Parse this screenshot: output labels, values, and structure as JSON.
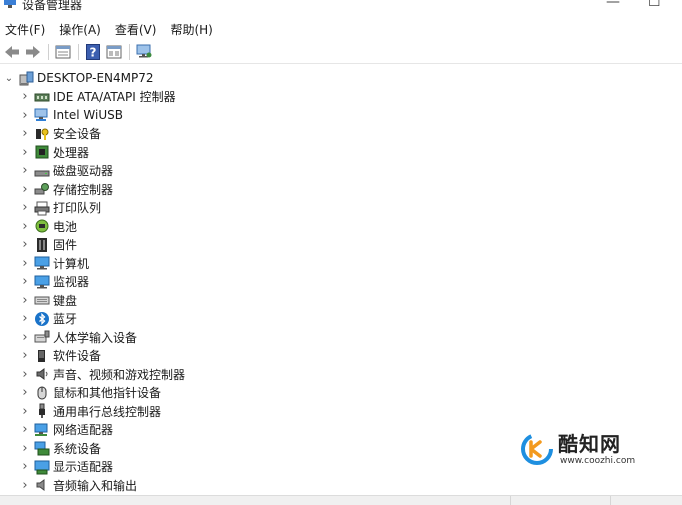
{
  "window": {
    "title": "设备管理器",
    "minimize_glyph": "—",
    "maximize_glyph": "☐"
  },
  "menu": [
    {
      "label": "文件(F)"
    },
    {
      "label": "操作(A)"
    },
    {
      "label": "查看(V)"
    },
    {
      "label": "帮助(H)"
    }
  ],
  "toolbar": {
    "buttons": [
      "back-arrow-icon",
      "forward-arrow-icon",
      "properties-icon",
      "help-icon",
      "view-icon",
      "monitor-scan-icon"
    ]
  },
  "tree": {
    "root": {
      "label": "DESKTOP-EN4MP72",
      "icon": "computer-tower-icon",
      "expanded": true
    },
    "items": [
      {
        "label": "IDE ATA/ATAPI 控制器",
        "icon": "ide-controller-icon"
      },
      {
        "label": "Intel WiUSB",
        "icon": "network-device-icon"
      },
      {
        "label": "安全设备",
        "icon": "security-key-icon"
      },
      {
        "label": "处理器",
        "icon": "processor-icon"
      },
      {
        "label": "磁盘驱动器",
        "icon": "disk-drive-icon"
      },
      {
        "label": "存储控制器",
        "icon": "storage-controller-icon"
      },
      {
        "label": "打印队列",
        "icon": "printer-icon"
      },
      {
        "label": "电池",
        "icon": "battery-icon"
      },
      {
        "label": "固件",
        "icon": "firmware-icon"
      },
      {
        "label": "计算机",
        "icon": "computer-icon"
      },
      {
        "label": "监视器",
        "icon": "monitor-icon"
      },
      {
        "label": "键盘",
        "icon": "keyboard-icon"
      },
      {
        "label": "蓝牙",
        "icon": "bluetooth-icon"
      },
      {
        "label": "人体学输入设备",
        "icon": "hid-icon"
      },
      {
        "label": "软件设备",
        "icon": "software-device-icon"
      },
      {
        "label": "声音、视频和游戏控制器",
        "icon": "speaker-icon"
      },
      {
        "label": "鼠标和其他指针设备",
        "icon": "mouse-icon"
      },
      {
        "label": "通用串行总线控制器",
        "icon": "usb-icon"
      },
      {
        "label": "网络适配器",
        "icon": "network-adapter-icon"
      },
      {
        "label": "系统设备",
        "icon": "system-device-icon"
      },
      {
        "label": "显示适配器",
        "icon": "display-adapter-icon"
      },
      {
        "label": "音频输入和输出",
        "icon": "audio-io-icon"
      }
    ]
  },
  "watermark": {
    "name": "酷知网",
    "url": "www.coozhi.com",
    "accent": "#1e8fe0",
    "accent2": "#f39a1e"
  },
  "colors": {
    "icon_blue": "#2f7fd6",
    "icon_dark": "#2b2b2b",
    "icon_green": "#3f8a3a",
    "toolbar_green": "#3b8a3e"
  }
}
